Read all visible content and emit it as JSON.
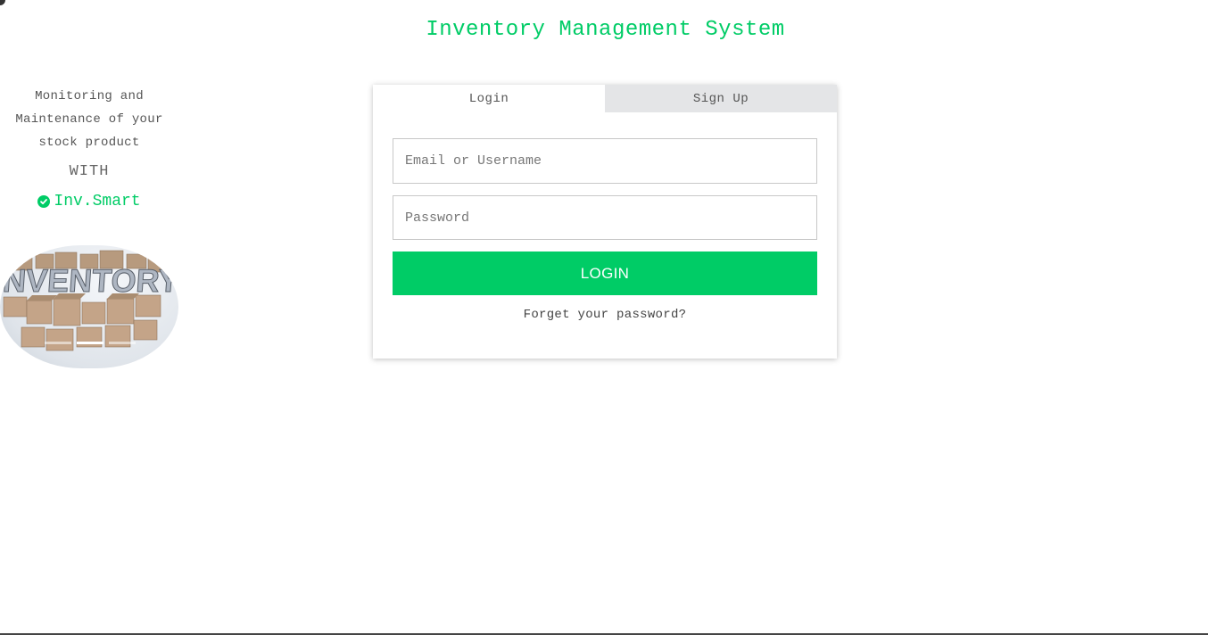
{
  "header": {
    "title": "Inventory Management System"
  },
  "side": {
    "tagline": "Monitoring and Maintenance of your stock product",
    "with_text": "WITH",
    "brand": "Inv.Smart",
    "brand_icon": "check-circle-icon",
    "carousel": {
      "image_text": "INVENTORY",
      "slide_count": 3,
      "active_slide": 2
    }
  },
  "login_card": {
    "tabs": [
      {
        "label": "Login",
        "active": true
      },
      {
        "label": "Sign Up",
        "active": false
      }
    ],
    "email_placeholder": "Email or Username",
    "password_placeholder": "Password",
    "email_value": "",
    "password_value": "",
    "login_label": "LOGIN",
    "forgot_label": "Forget your password?"
  },
  "colors": {
    "accent": "#00cc66",
    "tab_inactive_bg": "#e4e5e7",
    "text": "#555555"
  }
}
